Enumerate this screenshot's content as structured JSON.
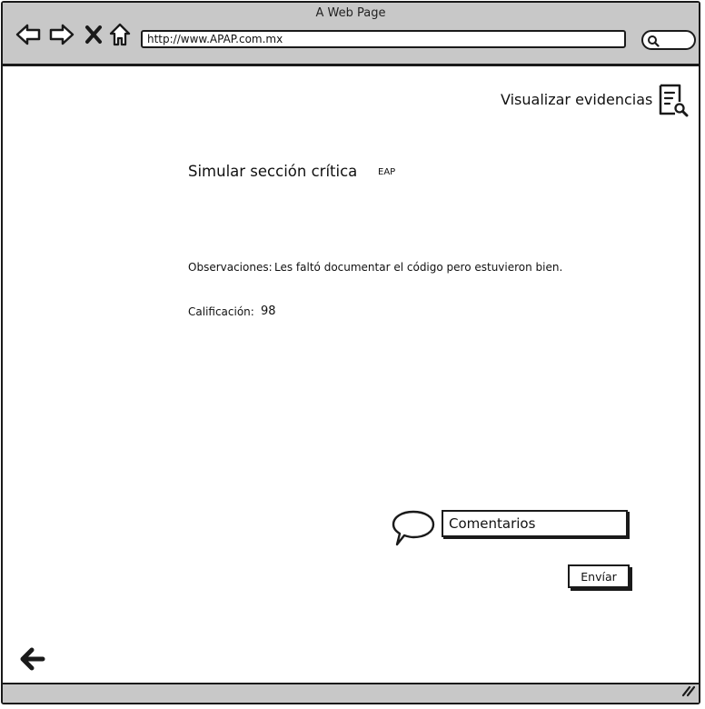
{
  "window": {
    "title": "A Web Page",
    "url": "http://www.APAP.com.mx"
  },
  "toolbar": {
    "icons": [
      "back-icon",
      "forward-icon",
      "close-icon",
      "home-icon",
      "search-icon"
    ]
  },
  "header": {
    "evidence_link": "Visualizar evidencias",
    "evidence_icon": "document-search-icon"
  },
  "section": {
    "title": "Simular sección crítica",
    "tag": "EAP"
  },
  "details": {
    "observations_label": "Observaciones:",
    "observations_text": "Les faltó documentar el código pero estuvieron bien.",
    "grade_label": "Calificación:",
    "grade_value": "98"
  },
  "comment": {
    "icon": "speech-bubble-icon",
    "placeholder": "Comentarios",
    "send_label": "Envíar"
  },
  "footer": {
    "back_icon": "arrow-left-icon"
  }
}
